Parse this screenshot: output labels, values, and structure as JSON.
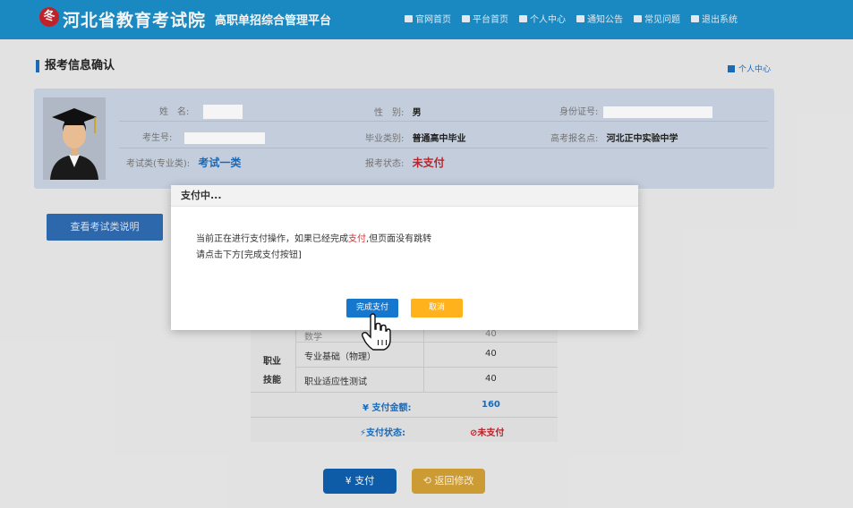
{
  "header": {
    "logo_glyph": "冬",
    "title": "河北省教育考试院",
    "subtitle": "高职单招综合管理平台",
    "nav": [
      {
        "label": "官网首页",
        "icon": "building-icon"
      },
      {
        "label": "平台首页",
        "icon": "paper-plane-icon"
      },
      {
        "label": "个人中心",
        "icon": "id-card-icon"
      },
      {
        "label": "通知公告",
        "icon": "document-icon"
      },
      {
        "label": "常见问题",
        "icon": "chat-icon"
      },
      {
        "label": "退出系统",
        "icon": "logout-icon"
      }
    ]
  },
  "page": {
    "title": "报考信息确认",
    "personal_center": "个人中心"
  },
  "info": {
    "name_label": "姓　名:",
    "gender_label": "性　别:",
    "gender_value": "男",
    "id_label": "身份证号:",
    "exam_no_label": "考生号:",
    "grad_type_label": "毕业类别:",
    "grad_type_value": "普通高中毕业",
    "site_label": "高考报名点:",
    "site_value": "河北正中实验中学",
    "category_label": "考试类(专业类):",
    "category_value": "考试一类",
    "status_label": "报考状态:",
    "status_value": "未支付"
  },
  "guide_button": "查看考试类说明",
  "fee_table": {
    "row_math": "数学",
    "row_math_fee": "40",
    "group_label_1": "职业",
    "group_label_2": "技能",
    "row_base": "专业基础（物理）",
    "row_base_fee": "40",
    "row_apt": "职业适应性测试",
    "row_apt_fee": "40",
    "amount_label": "¥ 支付金额:",
    "amount_value": "160",
    "pay_status_label": "支付状态:",
    "pay_status_value": "未支付"
  },
  "actions": {
    "pay": "¥ 支付",
    "back": "返回修改"
  },
  "modal": {
    "title": "支付中...",
    "line1_a": "当前正在进行支付操作，如果已经完成",
    "line1_red": "支付",
    "line1_b": ",但页面没有跳转",
    "line2": "请点击下方[完成支付按钮]",
    "done": "完成支付",
    "cancel": "取消"
  },
  "colors": {
    "topbar": "#1d8fc9",
    "primary": "#1677cf",
    "warning": "#ffb21c",
    "danger": "#c0262d"
  }
}
